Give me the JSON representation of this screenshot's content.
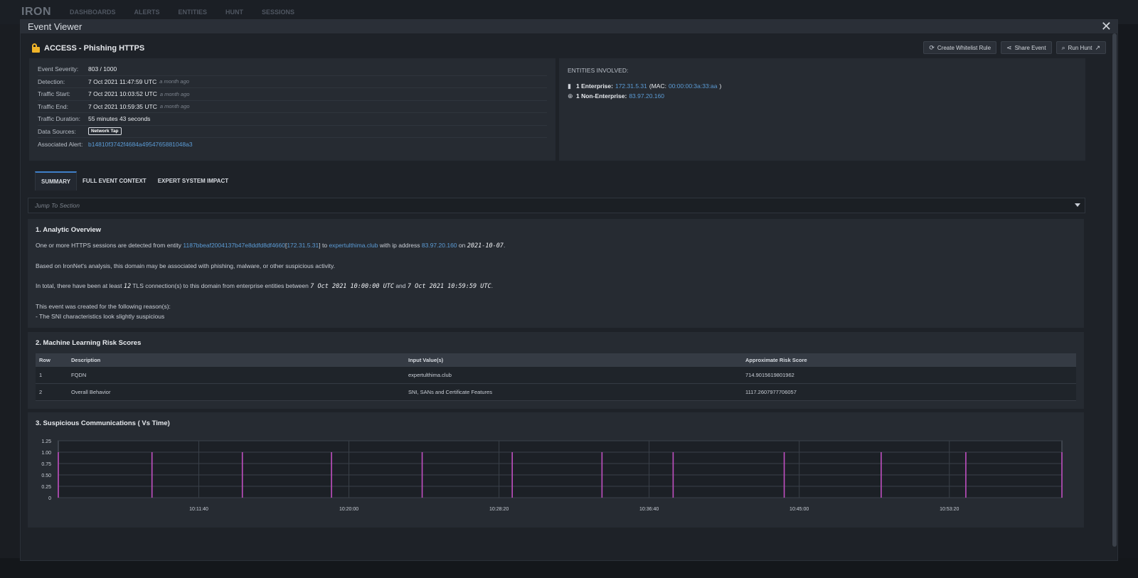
{
  "app": {
    "logo": "IRON",
    "nav": [
      "DASHBOARDS",
      "ALERTS",
      "ENTITIES",
      "HUNT",
      "SESSIONS"
    ]
  },
  "modal": {
    "title": "Event Viewer",
    "event_title": "ACCESS - Phishing HTTPS",
    "actions": {
      "whitelist": "Create Whitelist Rule",
      "share": "Share Event",
      "hunt": "Run Hunt"
    }
  },
  "details": {
    "severity_label": "Event Severity:",
    "severity": "803 / 1000",
    "detection_label": "Detection:",
    "detection": "7 Oct 2021 11:47:59 UTC",
    "traffic_start_label": "Traffic Start:",
    "traffic_start": "7 Oct 2021 10:03:52 UTC",
    "traffic_end_label": "Traffic End:",
    "traffic_end": "7 Oct 2021 10:59:35 UTC",
    "ago": "a month ago",
    "duration_label": "Traffic Duration:",
    "duration": "55 minutes 43 seconds",
    "sources_label": "Data Sources:",
    "source": "Network Tap",
    "alert_label": "Associated Alert:",
    "alert": "b14810f3742f4684a4954765881048a3"
  },
  "entities": {
    "title": "ENTITIES INVOLVED:",
    "enterprise_label": "1 Enterprise:",
    "enterprise_ip": "172.31.5.31",
    "mac_prefix": "(MAC:",
    "mac": "00:00:00:3a:33:aa",
    "mac_suffix": ")",
    "non_enterprise_label": "1 Non-Enterprise:",
    "non_enterprise_ip": "83.97.20.160"
  },
  "tabs": [
    "SUMMARY",
    "FULL EVENT CONTEXT",
    "EXPERT SYSTEM IMPACT"
  ],
  "jump": {
    "placeholder": "Jump To Section"
  },
  "overview": {
    "title": "1. Analytic Overview",
    "p1_a": "One or more HTTPS sessions are detected from entity",
    "entity_id": "1187bbeaf2004137b47e8ddfd8df4660",
    "bracket_open": "[",
    "entity_ip": "172.31.5.31",
    "bracket_close": "]",
    "p1_b": "to",
    "domain": "expertulthima.club",
    "p1_c": "with ip address",
    "domain_ip": "83.97.20.160",
    "p1_d": "on",
    "date": "2021-10-07",
    "period": ".",
    "p2": "Based on IronNet's analysis, this domain may be associated with phishing, malware, or other suspicious activity.",
    "p3_a": "In total, there have been at least",
    "count": "12",
    "p3_b": "TLS connection(s) to this domain from enterprise entities between",
    "from": "7 Oct 2021 10:00:00 UTC",
    "p3_c": "and",
    "to": "7 Oct 2021 10:59:59 UTC",
    "p4": "This event was created for the following reason(s):",
    "p5": "- The SNI characteristics look slightly suspicious"
  },
  "scores": {
    "title": "2. Machine Learning Risk Scores",
    "headers": [
      "Row",
      "Description",
      "Input Value(s)",
      "Approximate Risk Score"
    ],
    "rows": [
      [
        "1",
        "FQDN",
        "expertulthima.club",
        "714.9015619801962"
      ],
      [
        "2",
        "Overall Behavior",
        "SNI, SANs and Certificate Features",
        "1117.2607977706057"
      ]
    ]
  },
  "comms": {
    "title": "3. Suspicious Communications ( Vs Time)"
  },
  "chart_data": {
    "type": "bar",
    "title": "3. Suspicious Communications ( Vs Time)",
    "xlabel": "",
    "ylabel": "",
    "x_ticks": [
      "10:11:40",
      "10:20:00",
      "10:28:20",
      "10:36:40",
      "10:45:00",
      "10:53:20"
    ],
    "x_tick_seconds": [
      700,
      1200,
      1700,
      2200,
      2700,
      3200
    ],
    "xlim_seconds": [
      232,
      3575
    ],
    "ylim": [
      0,
      1.25
    ],
    "y_ticks": [
      "0",
      "0.25",
      "0.50",
      "0.75",
      "1.00",
      "1.25"
    ],
    "y_tick_values": [
      0,
      0.25,
      0.5,
      0.75,
      1.0,
      1.25
    ],
    "series": [
      {
        "x_seconds": [
          232,
          544,
          845,
          1142,
          1444,
          1744,
          2043,
          2280,
          2650,
          2973,
          3255,
          3575
        ],
        "values": [
          1,
          1,
          1,
          1,
          1,
          1,
          1,
          1,
          1,
          1,
          1,
          1
        ]
      }
    ],
    "color": "#c04fc1",
    "grid": true
  }
}
